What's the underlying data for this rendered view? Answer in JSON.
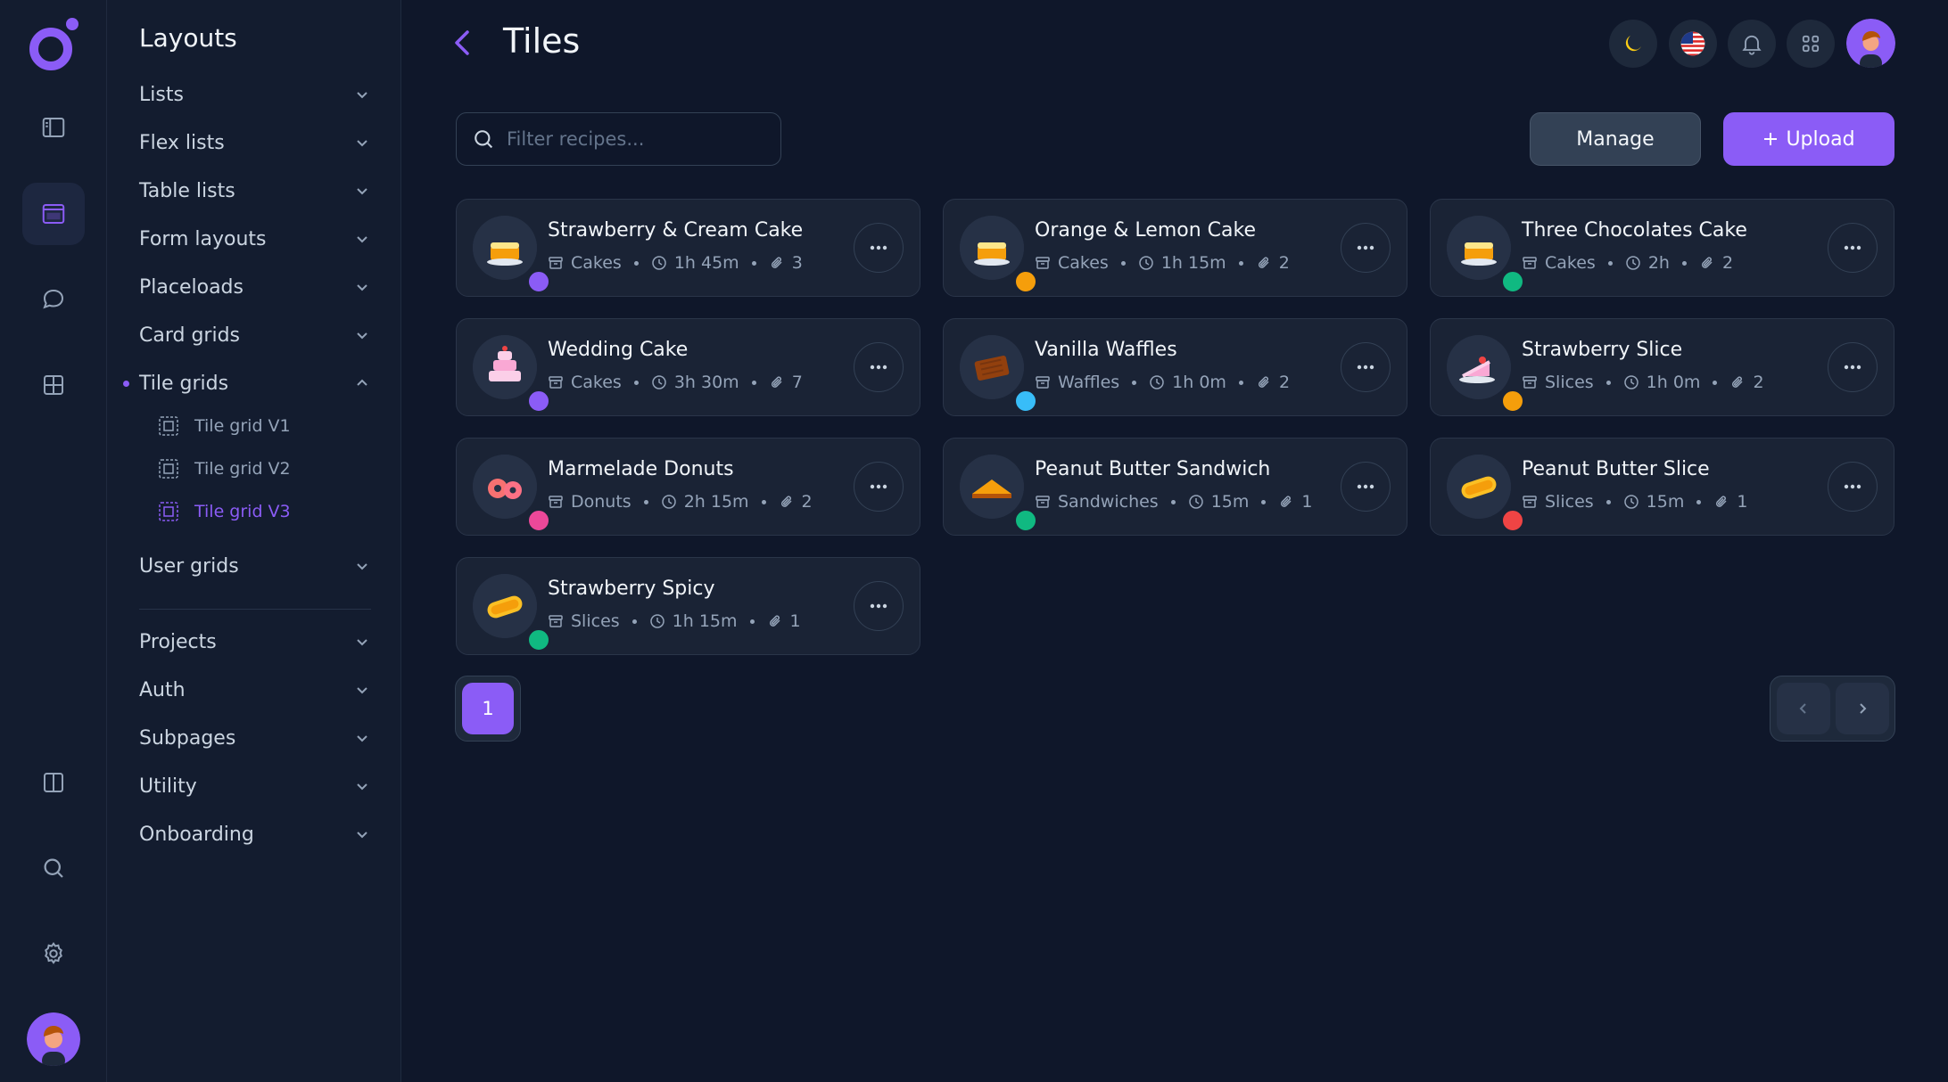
{
  "sidebar": {
    "title": "Layouts",
    "items": [
      {
        "label": "Lists"
      },
      {
        "label": "Flex lists"
      },
      {
        "label": "Table lists"
      },
      {
        "label": "Form layouts"
      },
      {
        "label": "Placeloads"
      },
      {
        "label": "Card grids"
      },
      {
        "label": "Tile grids",
        "expanded": true
      },
      {
        "label": "User grids"
      },
      {
        "label": "Projects"
      },
      {
        "label": "Auth"
      },
      {
        "label": "Subpages"
      },
      {
        "label": "Utility"
      },
      {
        "label": "Onboarding"
      }
    ],
    "subitems": [
      {
        "label": "Tile grid V1"
      },
      {
        "label": "Tile grid V2"
      },
      {
        "label": "Tile grid V3",
        "active": true
      }
    ]
  },
  "header": {
    "title": "Tiles"
  },
  "toolbar": {
    "search_placeholder": "Filter recipes...",
    "manage_label": "Manage",
    "upload_label": "Upload"
  },
  "recipes": [
    {
      "name": "Strawberry & Cream Cake",
      "category": "Cakes",
      "time": "1h 45m",
      "attachments": "3",
      "icon": "cake-icon",
      "avatar_color": "#8b5cf6"
    },
    {
      "name": "Orange & Lemon Cake",
      "category": "Cakes",
      "time": "1h 15m",
      "attachments": "2",
      "icon": "cake-icon",
      "avatar_color": "#f59e0b"
    },
    {
      "name": "Three Chocolates Cake",
      "category": "Cakes",
      "time": "2h",
      "attachments": "2",
      "icon": "cake-icon",
      "avatar_color": "#10b981"
    },
    {
      "name": "Wedding Cake",
      "category": "Cakes",
      "time": "3h 30m",
      "attachments": "7",
      "icon": "wedding-cake-icon",
      "avatar_color": "#8b5cf6"
    },
    {
      "name": "Vanilla Waffles",
      "category": "Waffles",
      "time": "1h 0m",
      "attachments": "2",
      "icon": "waffle-icon",
      "avatar_color": "#38bdf8"
    },
    {
      "name": "Strawberry Slice",
      "category": "Slices",
      "time": "1h 0m",
      "attachments": "2",
      "icon": "cake-slice-icon",
      "avatar_color": "#f59e0b"
    },
    {
      "name": "Marmelade Donuts",
      "category": "Donuts",
      "time": "2h 15m",
      "attachments": "2",
      "icon": "donut-icon",
      "avatar_color": "#ec4899"
    },
    {
      "name": "Peanut Butter Sandwich",
      "category": "Sandwiches",
      "time": "15m",
      "attachments": "1",
      "icon": "sandwich-icon",
      "avatar_color": "#10b981"
    },
    {
      "name": "Peanut Butter Slice",
      "category": "Slices",
      "time": "15m",
      "attachments": "1",
      "icon": "bread-slice-icon",
      "avatar_color": "#ef4444"
    },
    {
      "name": "Strawberry Spicy",
      "category": "Slices",
      "time": "1h 15m",
      "attachments": "1",
      "icon": "bread-slice-icon",
      "avatar_color": "#10b981"
    }
  ],
  "pagination": {
    "current": "1"
  },
  "colors": {
    "accent": "#8b5cf6",
    "background": "#0f172a",
    "panel": "#131c2f",
    "tile": "#1a2335"
  }
}
